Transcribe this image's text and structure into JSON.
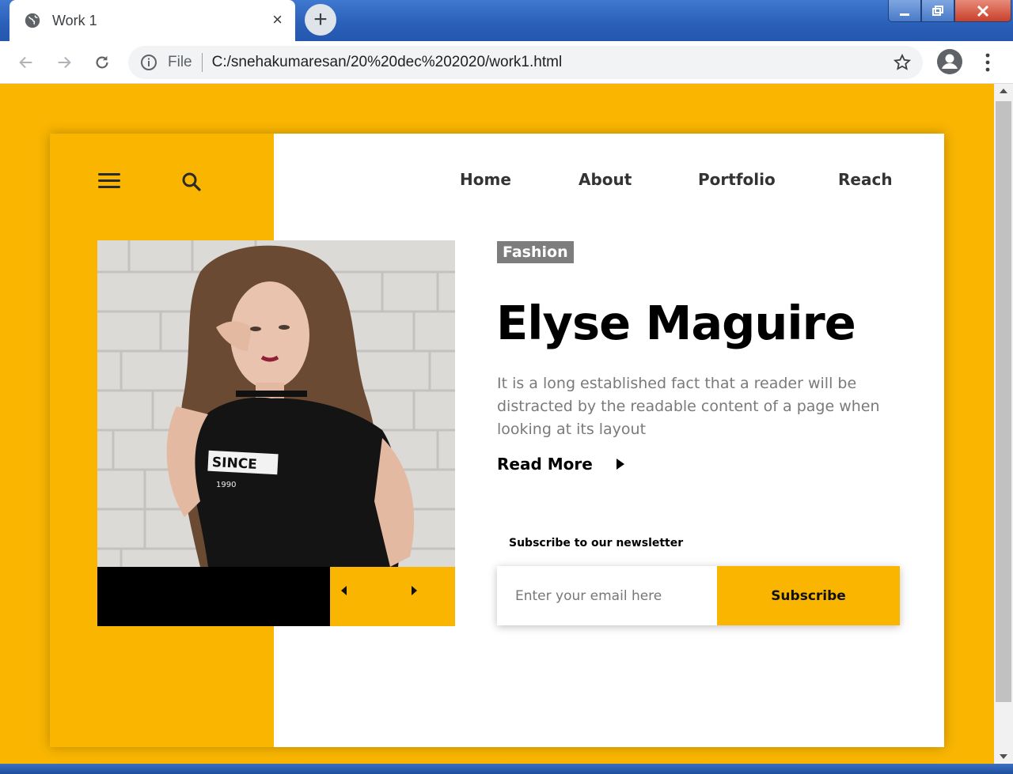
{
  "browser": {
    "tab_title": "Work 1",
    "tab_close": "×",
    "new_tab": "+",
    "scheme_label": "File",
    "url": "C:/snehakumaresan/20%20dec%202020/work1.html"
  },
  "site": {
    "nav": [
      "Home",
      "About",
      "Portfolio",
      "Reach"
    ],
    "category_badge": "Fashion",
    "headline": "Elyse Maguire",
    "description": "It is a long established fact that a reader will be distracted by the readable content of a page when looking at its layout",
    "read_more": "Read More",
    "newsletter_label": "Subscribe to our newsletter",
    "email_placeholder": "Enter your email here",
    "subscribe_label": "Subscribe",
    "photo_shirt_text": "SINCE",
    "photo_shirt_year": "1990"
  },
  "colors": {
    "accent_yellow": "#f9b500",
    "badge_gray": "#7d7d7d",
    "text_dark": "#333333",
    "text_muted": "#7a7a7a"
  },
  "icons": [
    "globe-icon",
    "close-icon",
    "plus-icon",
    "back-icon",
    "forward-icon",
    "reload-icon",
    "info-icon",
    "star-icon",
    "profile-icon",
    "kebab-menu-icon",
    "hamburger-icon",
    "search-icon",
    "arrow-left-icon",
    "arrow-right-icon",
    "play-triangle-icon"
  ]
}
